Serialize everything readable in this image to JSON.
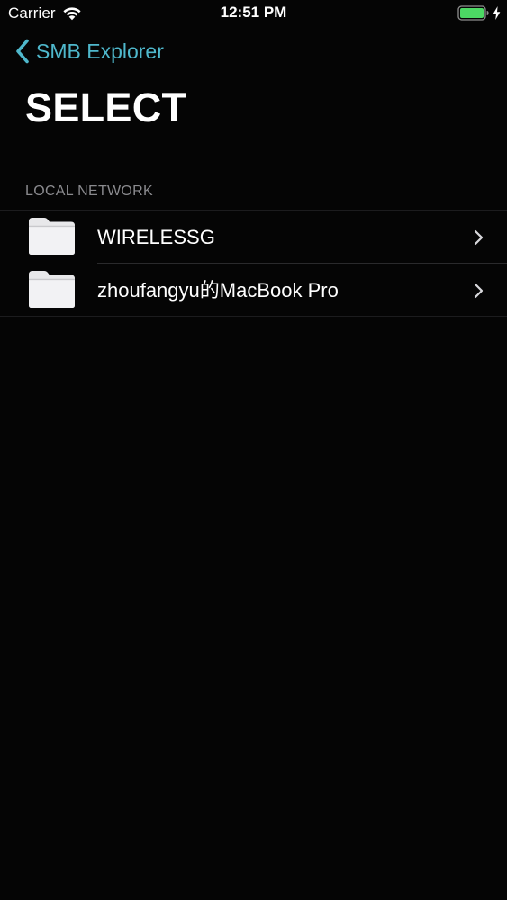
{
  "status_bar": {
    "carrier": "Carrier",
    "time": "12:51 PM",
    "wifi_icon": "wifi-icon",
    "battery_icon": "battery-icon",
    "charging_icon": "charging-bolt-icon",
    "battery_color": "#4cd964"
  },
  "nav": {
    "back_label": "SMB Explorer",
    "back_icon": "chevron-left-icon",
    "accent_color": "#4fb8cc"
  },
  "title": "SELECT",
  "section": {
    "header": "LOCAL NETWORK",
    "items": [
      {
        "label": "WIRELESSG",
        "icon": "folder-icon",
        "accessory": "chevron-right-icon"
      },
      {
        "label": "zhoufangyu的MacBook Pro",
        "icon": "folder-icon",
        "accessory": "chevron-right-icon"
      }
    ]
  }
}
